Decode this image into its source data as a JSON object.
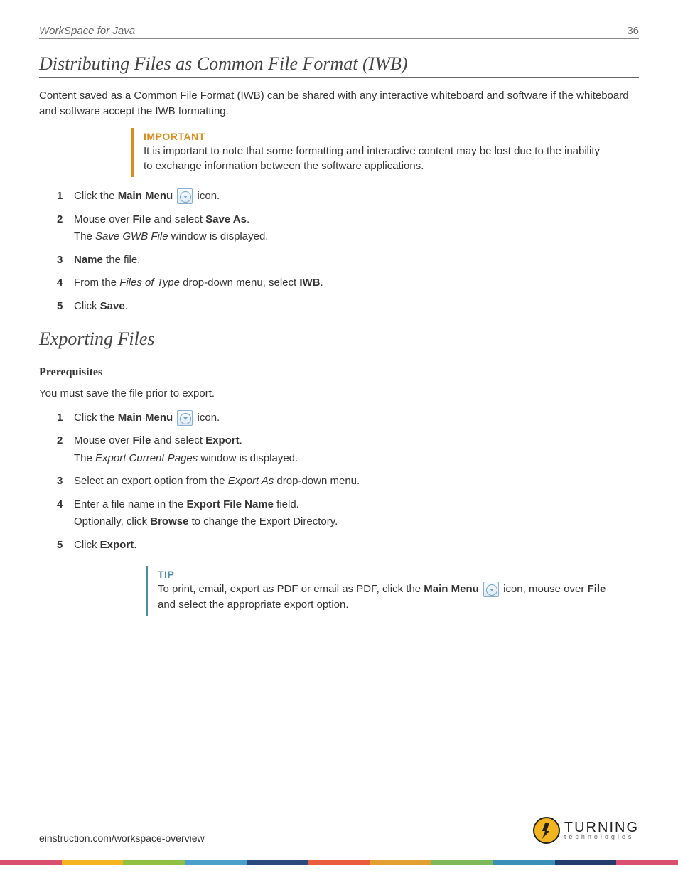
{
  "header": {
    "title": "WorkSpace for Java",
    "pageNumber": "36"
  },
  "section1": {
    "heading": "Distributing Files as Common File Format (IWB)",
    "intro": "Content saved as a Common File Format (IWB) can be shared with any interactive whiteboard and software if the whiteboard and software accept the IWB formatting.",
    "important": {
      "label": "IMPORTANT",
      "text": "It is important to note that some formatting and interactive content may be lost due to the inability to exchange information between the software applications."
    },
    "steps": {
      "s1a": "Click the ",
      "s1b": "Main Menu",
      "s1c": " icon.",
      "s2a": "Mouse over ",
      "s2b": "File",
      "s2c": " and select ",
      "s2d": "Save As",
      "s2e": ".",
      "s2suba": "The ",
      "s2subb": "Save GWB File",
      "s2subc": " window is displayed.",
      "s3a": "Name",
      "s3b": " the file.",
      "s4a": "From the ",
      "s4b": "Files of Type",
      "s4c": " drop-down menu, select ",
      "s4d": "IWB",
      "s4e": ".",
      "s5a": "Click ",
      "s5b": "Save",
      "s5c": "."
    }
  },
  "section2": {
    "heading": "Exporting Files",
    "prereqHeading": "Prerequisites",
    "prereqText": "You must save the file prior to export.",
    "steps": {
      "s1a": "Click the ",
      "s1b": "Main Menu",
      "s1c": " icon.",
      "s2a": "Mouse over ",
      "s2b": "File",
      "s2c": " and select ",
      "s2d": "Export",
      "s2e": ".",
      "s2suba": "The ",
      "s2subb": "Export Current Pages",
      "s2subc": " window is displayed.",
      "s3a": "Select an export option from the ",
      "s3b": "Export As",
      "s3c": " drop-down menu.",
      "s4a": "Enter a file name in the ",
      "s4b": "Export File Name",
      "s4c": " field.",
      "s4suba": "Optionally, click ",
      "s4subb": "Browse",
      "s4subc": " to change the Export Directory.",
      "s5a": "Click ",
      "s5b": "Export",
      "s5c": "."
    },
    "tip": {
      "label": "TIP",
      "p1": "To print, email, export as PDF or email as PDF, click the ",
      "p2": "Main Menu",
      "p3": " icon, mouse over ",
      "p4": "File",
      "p5": " and select the appropriate export option."
    }
  },
  "footer": {
    "url": "einstruction.com/workspace-overview",
    "logo1": "TURNING",
    "logo2": "technologies"
  },
  "colors": [
    "#d94f6f",
    "#f3b51f",
    "#8fc041",
    "#4aa0c9",
    "#2a4a7f",
    "#e95c3e",
    "#e2a030",
    "#7fb85a",
    "#3a8fb8",
    "#223c6e",
    "#d94f6f"
  ]
}
